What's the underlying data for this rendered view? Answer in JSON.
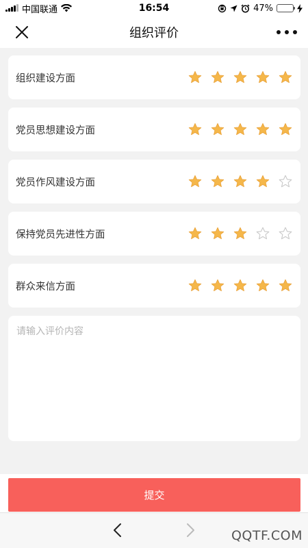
{
  "status_bar": {
    "carrier": "中国联通",
    "time": "16:54",
    "battery_percent": "47%",
    "battery_level": 0.47,
    "icons": [
      "signal-icon",
      "wifi-icon",
      "orientation-lock-icon",
      "location-icon",
      "alarm-icon",
      "battery-icon",
      "charging-icon"
    ]
  },
  "nav": {
    "title": "组织评价",
    "close_icon": "close-icon",
    "more_icon": "more-icon"
  },
  "ratings": [
    {
      "label": "组织建设方面",
      "score": 5,
      "max": 5
    },
    {
      "label": "党员思想建设方面",
      "score": 5,
      "max": 5
    },
    {
      "label": "党员作风建设方面",
      "score": 4,
      "max": 5
    },
    {
      "label": "保持党员先进性方面",
      "score": 3,
      "max": 5
    },
    {
      "label": "群众来信方面",
      "score": 5,
      "max": 5
    }
  ],
  "comment": {
    "placeholder": "请输入评价内容",
    "value": ""
  },
  "submit": {
    "label": "提交"
  },
  "browser": {
    "back_icon": "chevron-left-icon",
    "forward_icon": "chevron-right-icon"
  },
  "watermark": "QQTF.COM",
  "colors": {
    "star_filled": "#f5b74a",
    "star_empty": "#c8c8c8",
    "submit_bg": "#f8605b",
    "page_bg": "#f2f2f2"
  }
}
